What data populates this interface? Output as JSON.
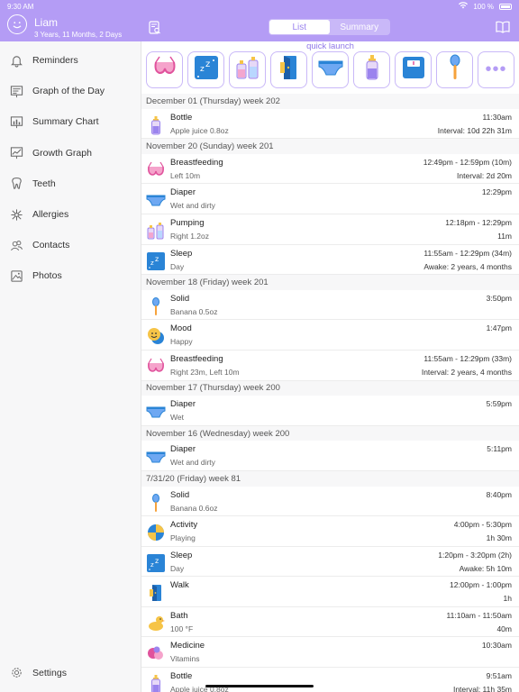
{
  "status_bar": {
    "time": "9:30 AM",
    "battery": "100 %"
  },
  "header": {
    "child_name": "Liam",
    "child_age": "3 Years, 11 Months, 2 Days",
    "segments": [
      {
        "label": "List",
        "active": true
      },
      {
        "label": "Summary",
        "active": false
      }
    ]
  },
  "sidebar": {
    "items": [
      {
        "label": "Reminders",
        "icon": "bell-icon"
      },
      {
        "label": "Graph of the Day",
        "icon": "graph-day-icon"
      },
      {
        "label": "Summary Chart",
        "icon": "summary-chart-icon"
      },
      {
        "label": "Growth Graph",
        "icon": "growth-graph-icon"
      },
      {
        "label": "Teeth",
        "icon": "tooth-icon"
      },
      {
        "label": "Allergies",
        "icon": "allergy-icon"
      },
      {
        "label": "Contacts",
        "icon": "contacts-icon"
      },
      {
        "label": "Photos",
        "icon": "photos-icon"
      }
    ],
    "settings_label": "Settings"
  },
  "quick_launch": {
    "title": "quick launch",
    "items": [
      "breastfeeding-icon",
      "sleep-icon",
      "pumping-icon",
      "walk-icon",
      "diaper-icon",
      "bottle-icon",
      "scale-icon",
      "solid-icon",
      "more-icon"
    ],
    "more_label": "•••"
  },
  "feed": [
    {
      "header": "December 01 (Thursday) week 202",
      "entries": [
        {
          "icon": "bottle",
          "title": "Bottle",
          "sub": "Apple juice 0.8oz",
          "time": "11:30am",
          "interval": "Interval: 10d 22h 31m"
        }
      ]
    },
    {
      "header": "November 20 (Sunday) week 201",
      "entries": [
        {
          "icon": "breastfeeding",
          "title": "Breastfeeding",
          "sub": "Left 10m",
          "time": "12:49pm - 12:59pm (10m)",
          "interval": "Interval: 2d 20m"
        },
        {
          "icon": "diaper",
          "title": "Diaper",
          "sub": "Wet and dirty",
          "time": "12:29pm",
          "interval": ""
        },
        {
          "icon": "pumping",
          "title": "Pumping",
          "sub": "Right 1.2oz",
          "time": "12:18pm - 12:29pm",
          "interval": "11m"
        },
        {
          "icon": "sleep",
          "title": "Sleep",
          "sub": "Day",
          "time": "11:55am - 12:29pm (34m)",
          "interval": "Awake: 2 years, 4 months"
        }
      ]
    },
    {
      "header": "November 18 (Friday) week 201",
      "entries": [
        {
          "icon": "solid",
          "title": "Solid",
          "sub": "Banana 0.5oz",
          "time": "3:50pm",
          "interval": ""
        },
        {
          "icon": "mood",
          "title": "Mood",
          "sub": "Happy",
          "time": "1:47pm",
          "interval": ""
        },
        {
          "icon": "breastfeeding",
          "title": "Breastfeeding",
          "sub": "Right 23m, Left 10m",
          "time": "11:55am - 12:29pm (33m)",
          "interval": "Interval: 2 years, 4 months"
        }
      ]
    },
    {
      "header": "November 17 (Thursday) week 200",
      "entries": [
        {
          "icon": "diaper",
          "title": "Diaper",
          "sub": "Wet",
          "time": "5:59pm",
          "interval": ""
        }
      ]
    },
    {
      "header": "November 16 (Wednesday) week 200",
      "entries": [
        {
          "icon": "diaper",
          "title": "Diaper",
          "sub": "Wet and dirty",
          "time": "5:11pm",
          "interval": ""
        }
      ]
    },
    {
      "header": "7/31/20 (Friday) week 81",
      "entries": [
        {
          "icon": "solid",
          "title": "Solid",
          "sub": "Banana 0.6oz",
          "time": "8:40pm",
          "interval": ""
        },
        {
          "icon": "activity",
          "title": "Activity",
          "sub": "Playing",
          "time": "4:00pm - 5:30pm",
          "interval": "1h 30m"
        },
        {
          "icon": "sleep",
          "title": "Sleep",
          "sub": "Day",
          "time": "1:20pm - 3:20pm (2h)",
          "interval": "Awake: 5h 10m"
        },
        {
          "icon": "walk",
          "title": "Walk",
          "sub": "",
          "time": "12:00pm - 1:00pm",
          "interval": "1h"
        },
        {
          "icon": "bath",
          "title": "Bath",
          "sub": "100 °F",
          "time": "11:10am - 11:50am",
          "interval": "40m"
        },
        {
          "icon": "medicine",
          "title": "Medicine",
          "sub": "Vitamins",
          "time": "10:30am",
          "interval": ""
        },
        {
          "icon": "bottle",
          "title": "Bottle",
          "sub": "Apple juice 0.8oz",
          "time": "9:51am",
          "interval": "Interval: 11h 35m"
        }
      ]
    }
  ]
}
